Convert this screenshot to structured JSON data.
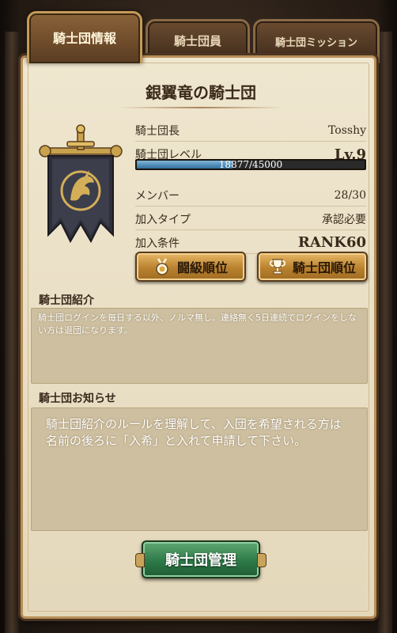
{
  "tabs": [
    {
      "label": "騎士団情報",
      "active": true
    },
    {
      "label": "騎士団員",
      "active": false
    },
    {
      "label": "騎士団ミッション",
      "active": false
    }
  ],
  "guild": {
    "name": "銀翼竜の騎士団",
    "emblem_icon": "dragon-banner-emblem"
  },
  "info": {
    "leader_label": "騎士団長",
    "leader_value": "Tosshy",
    "level_label": "騎士団レベル",
    "level_value": "Lv.9",
    "exp_text": "18877/45000",
    "exp_current": 18877,
    "exp_max": 45000,
    "member_label": "メンバー",
    "member_value": "28/30",
    "join_type_label": "加入タイプ",
    "join_type_value": "承認必要",
    "join_cond_label": "加入条件",
    "join_cond_value": "RANK60"
  },
  "buttons": {
    "battle_rank": "闘級順位",
    "battle_rank_icon": "medal-icon",
    "guild_rank": "騎士団順位",
    "guild_rank_icon": "trophy-icon",
    "manage": "騎士団管理"
  },
  "intro": {
    "title": "騎士団紹介",
    "text": "騎士団ログインを毎日する以外、ノルマ無し。連絡無く5日連続でログインをしない方は退団になります。"
  },
  "notice": {
    "title": "騎士団お知らせ",
    "text": "騎士団紹介のルールを理解して、入団を希望される方は名前の後ろに「入希」と入れて申請して下さい。"
  },
  "colors": {
    "panel": "#efe6cf",
    "gold_button": "#b9822f",
    "green_button": "#2d7a48",
    "exp_bar": "#2f6f9e"
  }
}
